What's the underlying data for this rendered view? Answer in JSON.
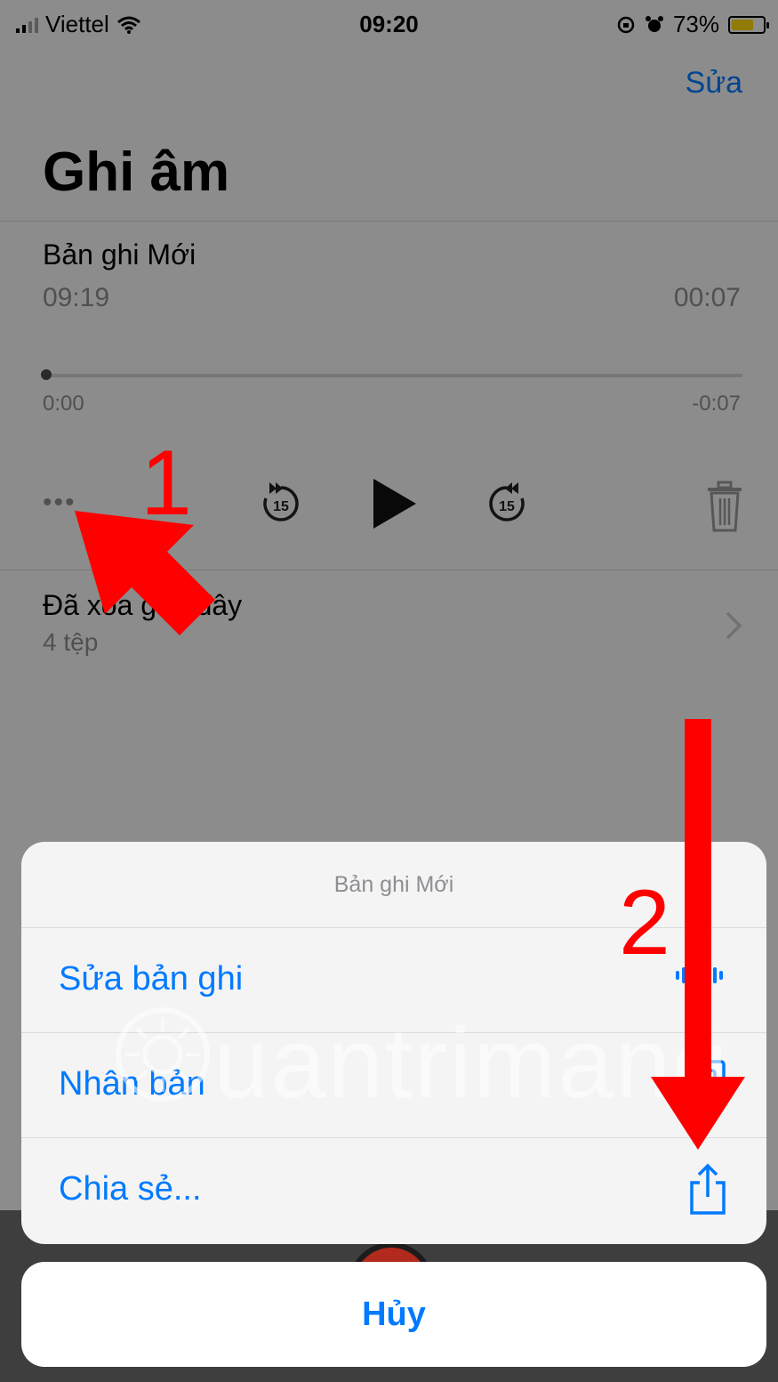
{
  "status_bar": {
    "carrier": "Viettel",
    "time": "09:20",
    "battery_percent": "73%",
    "battery_level": 0.73,
    "icons": [
      "signal-icon",
      "wifi-icon",
      "rotation-lock-icon",
      "alarm-icon",
      "battery-icon"
    ]
  },
  "header": {
    "edit_label": "Sửa",
    "title": "Ghi âm"
  },
  "recording": {
    "title": "Bản ghi Mới",
    "date": "09:19",
    "duration": "00:07",
    "elapsed": "0:00",
    "remaining": "-0:07",
    "progress": 0.0,
    "more_label": "•••",
    "skip_back_seconds": "15",
    "skip_forward_seconds": "15"
  },
  "recently_deleted": {
    "title": "Đã xóa gần đây",
    "count_label": "4 tệp"
  },
  "action_sheet": {
    "title": "Bản ghi Mới",
    "items": [
      {
        "label": "Sửa bản ghi",
        "icon": "waveform-icon"
      },
      {
        "label": "Nhân bản",
        "icon": "duplicate-icon"
      },
      {
        "label": "Chia sẻ...",
        "icon": "share-icon"
      }
    ],
    "cancel_label": "Hủy"
  },
  "annotations": {
    "step1": "1",
    "step2": "2",
    "arrow_color": "#ff0000"
  },
  "watermark": {
    "text": "uantrimang"
  },
  "colors": {
    "accent": "#007aff",
    "secondary_text": "#8e8e93",
    "annotation": "#ff0000",
    "battery": "#ffd60a"
  }
}
